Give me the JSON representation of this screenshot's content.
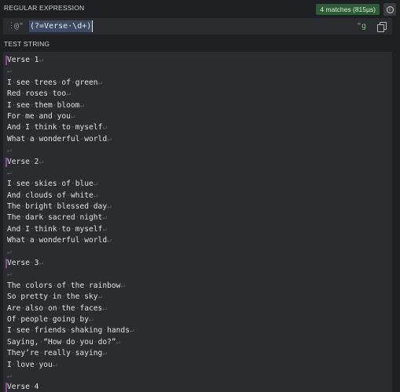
{
  "regex_section": {
    "label": "REGULAR EXPRESSION",
    "badge": "4 matches (815µs)",
    "info_icon": "i",
    "grip": "⋮",
    "delimiter": "@\"",
    "pattern": "(?=Verse·\\d+)",
    "closing_quote": "\"",
    "flags": "g"
  },
  "test_section": {
    "label": "TEST STRING"
  },
  "icons": {
    "grip": "grip-icon",
    "info": "info-icon",
    "copy": "copy-icon"
  },
  "colors": {
    "badge_bg": "#2f5a37",
    "match_marker": "#8a4a9e",
    "selection": "#3d4a63"
  },
  "test_lines": [
    "Verse 1",
    "",
    "I see trees of green",
    "Red roses too",
    "I see them bloom",
    "For me and you",
    "And I think to myself",
    "What a wonderful world",
    "",
    "Verse 2",
    "",
    "I see skies of blue",
    "And clouds of white",
    "The bright blessed day",
    "The dark sacred night",
    "And I think to myself",
    "What a wonderful world",
    "",
    "Verse 3",
    "",
    "The colors of the rainbow",
    "So pretty in the sky",
    "Are also on the faces",
    "Of people going by",
    "I see friends shaking hands",
    "Saying, “How do you do?”",
    "They’re really saying",
    "I love you",
    "",
    "Verse 4"
  ],
  "match_line_indices": [
    0,
    9,
    18,
    29
  ]
}
